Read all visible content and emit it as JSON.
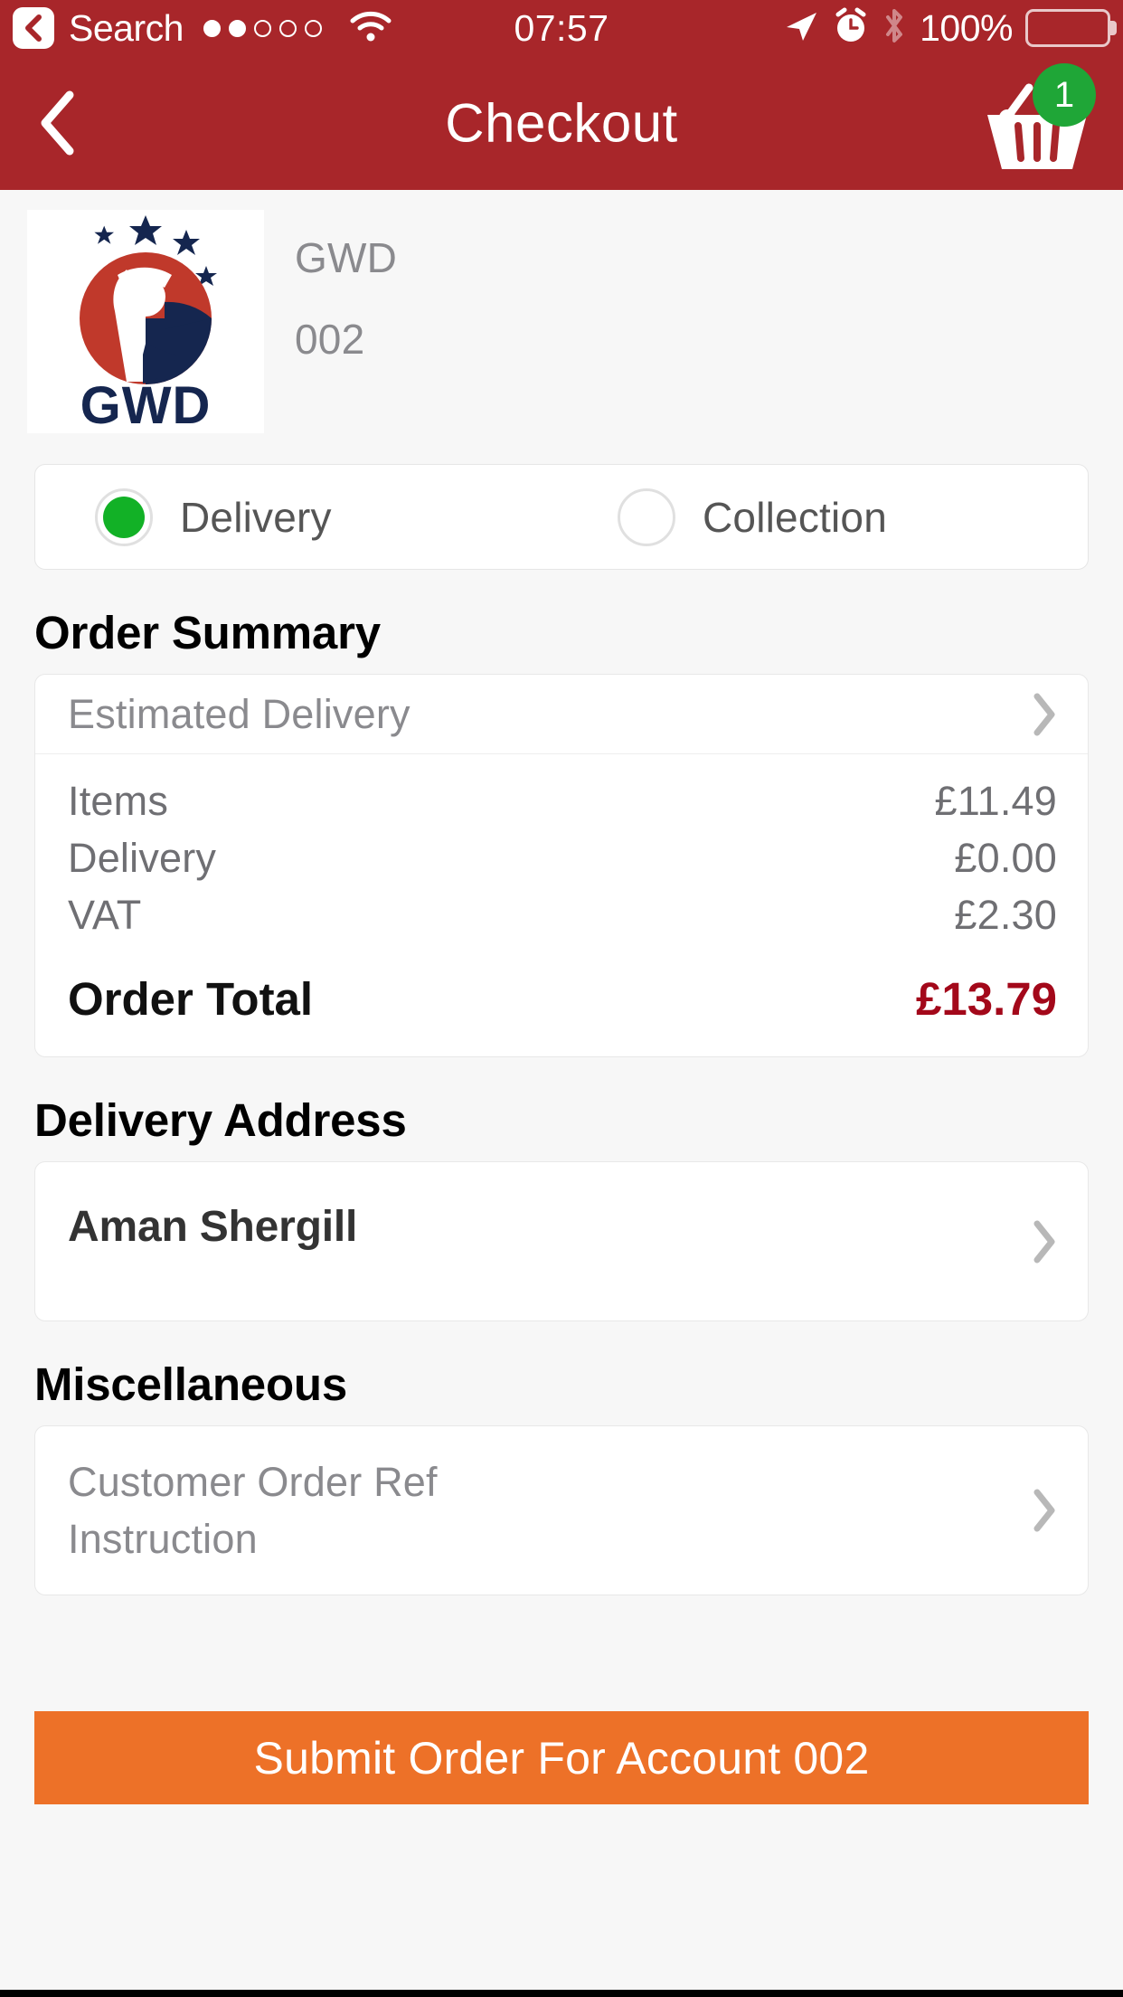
{
  "status_bar": {
    "back_label": "Search",
    "back_icon": "chevron-left-boxed-icon",
    "signal_dots_filled": 2,
    "signal_dots_total": 5,
    "wifi_icon": "wifi-icon",
    "time": "07:57",
    "location_icon": "location-arrow-icon",
    "alarm_icon": "alarm-clock-icon",
    "bluetooth_icon": "bluetooth-icon",
    "battery_percent": "100%",
    "battery_icon": "battery-full-icon"
  },
  "nav": {
    "back_icon": "chevron-left-icon",
    "title": "Checkout",
    "basket_icon": "shopping-basket-icon",
    "basket_count": "1",
    "basket_badge_color": "#1FA637",
    "bar_color": "#A8262A"
  },
  "account": {
    "logo_alt": "gwd-logo",
    "logo_wordmark": "GWD",
    "name": "GWD",
    "number": "002"
  },
  "fulfilment": {
    "options": [
      {
        "label": "Delivery",
        "selected": true
      },
      {
        "label": "Collection",
        "selected": false
      }
    ],
    "selected_color": "#12B126"
  },
  "order_summary": {
    "title": "Order Summary",
    "estimated_delivery_label": "Estimated Delivery",
    "lines": [
      {
        "label": "Items",
        "value": "£11.49"
      },
      {
        "label": "Delivery",
        "value": "£0.00"
      },
      {
        "label": "VAT",
        "value": "£2.30"
      }
    ],
    "total_label": "Order Total",
    "total_value": "£13.79",
    "total_color": "#A3081A"
  },
  "delivery_address": {
    "title": "Delivery Address",
    "name": "Aman Shergill"
  },
  "miscellaneous": {
    "title": "Miscellaneous",
    "line1": "Customer Order Ref",
    "line2": "Instruction"
  },
  "submit": {
    "label": "Submit Order For Account 002",
    "color": "#ED7128"
  }
}
